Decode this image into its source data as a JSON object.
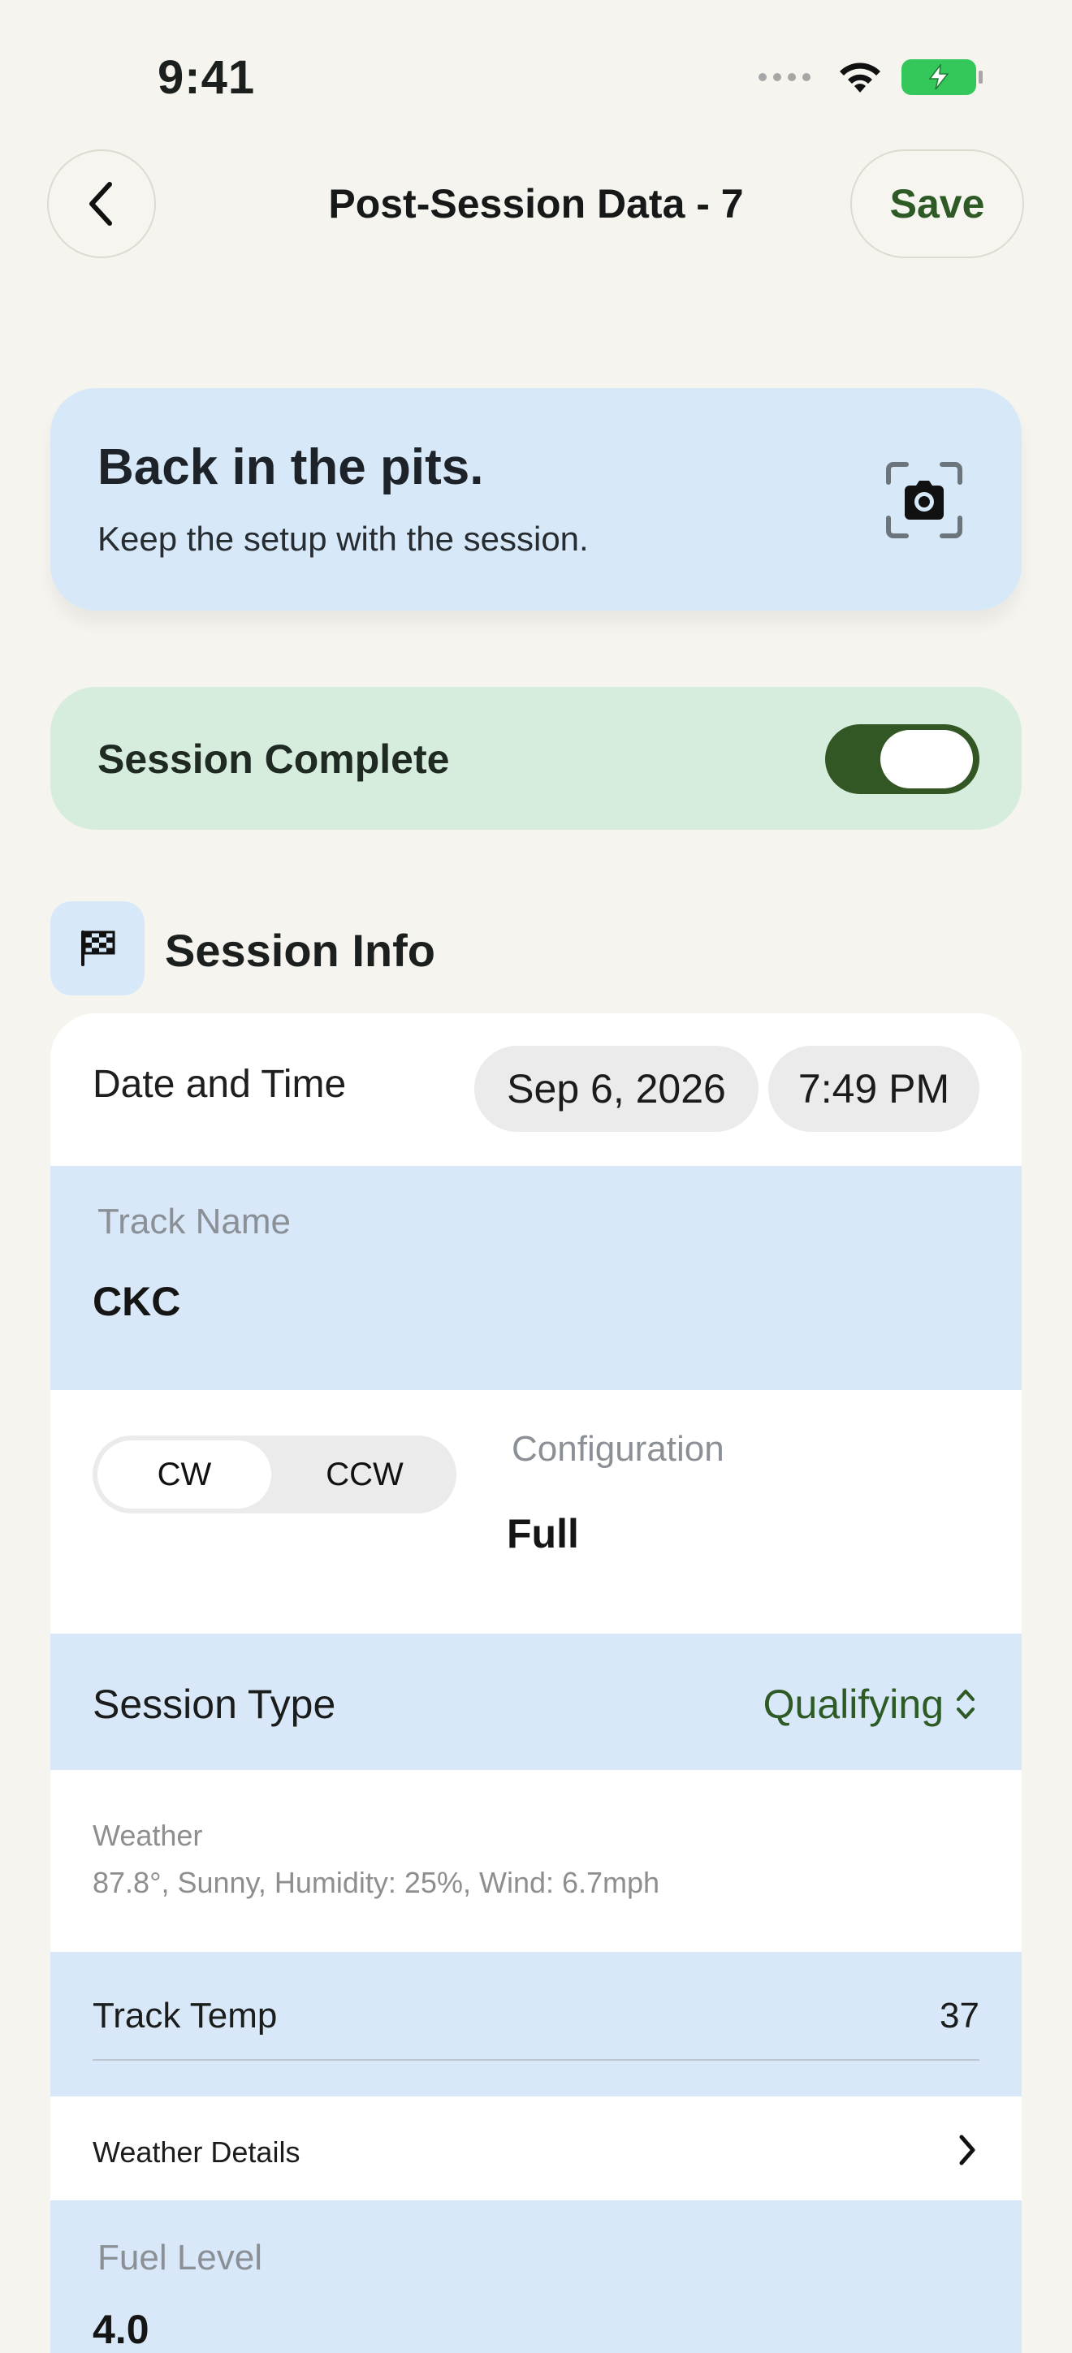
{
  "status_bar": {
    "time": "9:41"
  },
  "nav": {
    "title": "Post-Session Data - 7",
    "save_label": "Save"
  },
  "hero": {
    "title": "Back in the pits.",
    "subtitle": "Keep the setup with the session."
  },
  "session_complete": {
    "label": "Session Complete",
    "enabled": true
  },
  "section": {
    "title": "Session Info",
    "icon": "checkered-flag-icon"
  },
  "date_time": {
    "label": "Date and Time",
    "date": "Sep 6, 2026",
    "time": "7:49 PM"
  },
  "track_name": {
    "label": "Track Name",
    "value": "CKC"
  },
  "direction": {
    "options": [
      "CW",
      "CCW"
    ],
    "selected": "CW"
  },
  "configuration": {
    "label": "Configuration",
    "value": "Full"
  },
  "session_type": {
    "label": "Session Type",
    "value": "Qualifying"
  },
  "weather": {
    "label": "Weather",
    "value": "87.8°, Sunny, Humidity: 25%, Wind: 6.7mph"
  },
  "track_temp": {
    "label": "Track Temp",
    "value": "37"
  },
  "weather_details": {
    "label": "Weather Details"
  },
  "fuel_level": {
    "label": "Fuel Level",
    "value": "4.0"
  },
  "colors": {
    "accent_green": "#2d5a25",
    "toggle_on": "#325624",
    "panel_blue": "#d8e8f9",
    "panel_green": "#d6ecdd",
    "background": "#f5f4ee"
  }
}
